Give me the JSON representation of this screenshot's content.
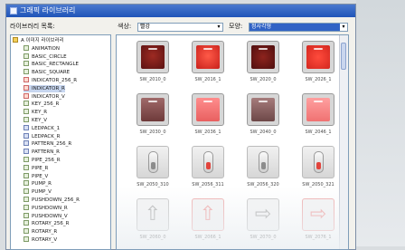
{
  "window": {
    "title": "그래픽 라이브러리"
  },
  "tree": {
    "header": "라이브러리 목록:",
    "items": [
      {
        "label": "A 이미지 라이브러리",
        "type": "folder"
      },
      {
        "label": "ANIMATION",
        "type": "item"
      },
      {
        "label": "BASIC_CIRCLE",
        "type": "item"
      },
      {
        "label": "BASIC_RECTANGLE",
        "type": "item"
      },
      {
        "label": "BASIC_SQUARE",
        "type": "item"
      },
      {
        "label": "INDICATOR_256_R",
        "type": "ind"
      },
      {
        "label": "INDICATOR_R",
        "type": "ind",
        "highlight": true
      },
      {
        "label": "INDICATOR_V",
        "type": "ind"
      },
      {
        "label": "KEY_256_R",
        "type": "item"
      },
      {
        "label": "KEY_R",
        "type": "item"
      },
      {
        "label": "KEY_V",
        "type": "item"
      },
      {
        "label": "LEDPACK_1",
        "type": "pat"
      },
      {
        "label": "LEDPACK_R",
        "type": "pat"
      },
      {
        "label": "PATTERN_256_R",
        "type": "pat"
      },
      {
        "label": "PATTERN_R",
        "type": "pat"
      },
      {
        "label": "PIPE_256_R",
        "type": "item"
      },
      {
        "label": "PIPE_R",
        "type": "item"
      },
      {
        "label": "PIPE_V",
        "type": "item"
      },
      {
        "label": "PUMP_R",
        "type": "item"
      },
      {
        "label": "PUMP_V",
        "type": "item"
      },
      {
        "label": "PUSHDOWN_256_R",
        "type": "item"
      },
      {
        "label": "PUSHDOWN_R",
        "type": "item"
      },
      {
        "label": "PUSHDOWN_V",
        "type": "item"
      },
      {
        "label": "ROTARY_256_R",
        "type": "item"
      },
      {
        "label": "ROTARY_R",
        "type": "item"
      },
      {
        "label": "ROTARY_V",
        "type": "item"
      }
    ]
  },
  "filters": {
    "color_label": "색상:",
    "color_value": "빨강",
    "shape_label": "모양:",
    "shape_value": "정사각형"
  },
  "icons": {
    "combo_arrow": "▾",
    "arrow_up": "⇧",
    "arrow_right": "⇨"
  },
  "tiles": [
    {
      "name": "SW_2010_0",
      "style": "dark-red"
    },
    {
      "name": "SW_2016_1",
      "style": "bright-red"
    },
    {
      "name": "SW_2020_0",
      "style": "dark-red-square"
    },
    {
      "name": "SW_2026_1",
      "style": "bright-red-square"
    },
    {
      "name": "SW_2030_0",
      "style": "muted-red"
    },
    {
      "name": "SW_2036_1",
      "style": "pink-red"
    },
    {
      "name": "SW_2040_0",
      "style": "muted-red-square"
    },
    {
      "name": "SW_2046_1",
      "style": "pink-red-square"
    },
    {
      "name": "SW_2050_310",
      "style": "toggle-gray"
    },
    {
      "name": "SW_2056_311",
      "style": "toggle-red"
    },
    {
      "name": "SW_2056_320",
      "style": "toggle-gray"
    },
    {
      "name": "SW_2050_321",
      "style": "toggle-red"
    },
    {
      "name": "SW_2060_0",
      "style": "arrow-up-gray"
    },
    {
      "name": "SW_2066_1",
      "style": "arrow-up-red"
    },
    {
      "name": "SW_2070_0",
      "style": "arrow-right-gray"
    },
    {
      "name": "SW_2076_1",
      "style": "arrow-right-red"
    }
  ],
  "colors": {
    "titlebar": "#2a5fbf",
    "selection": "#3163c5",
    "dark_red": "#7a1d1d",
    "bright_red": "#e0332e"
  }
}
